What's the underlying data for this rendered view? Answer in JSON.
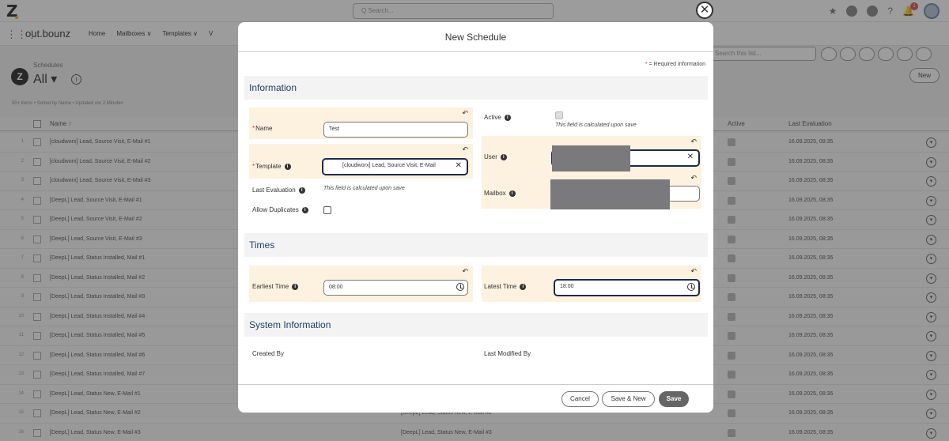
{
  "topbar": {
    "search_placeholder": "Q  Search...",
    "notification_count": "1"
  },
  "nav": {
    "app_name": "out.bounz",
    "items": [
      "Home",
      "Mailboxes ∨",
      "Templates ∨",
      "V"
    ]
  },
  "list": {
    "breadcrumb": "Schedules",
    "view": "All ▾",
    "meta": "50+ items • Sorted by Name • Updated vor 2 Minuten",
    "new_label": "New",
    "search_placeholder": "Search this list...",
    "col_name": "Name ↑",
    "col_active": "Active",
    "col_last": "Last Evaluation",
    "rows": [
      {
        "n": "1",
        "name": "[cloudworx] Lead, Source Visit, E-Mail #1",
        "tpl": "",
        "date": "16.09.2025, 08:35"
      },
      {
        "n": "2",
        "name": "[cloudworx] Lead, Source Visit, E-Mail #2",
        "tpl": "",
        "date": "16.09.2025, 08:35"
      },
      {
        "n": "3",
        "name": "[cloudworx] Lead, Source Visit, E-Mail #3",
        "tpl": "",
        "date": "16.09.2025, 08:35"
      },
      {
        "n": "4",
        "name": "[DeepL] Lead, Source Visit, E-Mail #1",
        "tpl": "",
        "date": "16.09.2025, 08:35"
      },
      {
        "n": "5",
        "name": "[DeepL] Lead, Source Visit, E-Mail #2",
        "tpl": "",
        "date": "16.09.2025, 08:35"
      },
      {
        "n": "6",
        "name": "[DeepL] Lead, Source Visit, E-Mail #3",
        "tpl": "",
        "date": "16.09.2025, 08:35"
      },
      {
        "n": "7",
        "name": "[DeepL] Lead, Status Installed, Mail #1",
        "tpl": "",
        "date": "16.09.2025, 08:35"
      },
      {
        "n": "8",
        "name": "[DeepL] Lead, Status Installed, Mail #2",
        "tpl": "",
        "date": "16.09.2025, 08:35"
      },
      {
        "n": "9",
        "name": "[DeepL] Lead, Status Installed, Mail #3",
        "tpl": "",
        "date": "16.09.2025, 08:35"
      },
      {
        "n": "10",
        "name": "[DeepL] Lead, Status Installed, Mail #4",
        "tpl": "",
        "date": "16.09.2025, 08:35"
      },
      {
        "n": "11",
        "name": "[DeepL] Lead, Status Installed, Mail #5",
        "tpl": "",
        "date": "16.09.2025, 08:35"
      },
      {
        "n": "12",
        "name": "[DeepL] Lead, Status Installed, Mail #6",
        "tpl": "",
        "date": "16.09.2025, 08:35"
      },
      {
        "n": "13",
        "name": "[DeepL] Lead, Status Installed, Mail #7",
        "tpl": "",
        "date": "16.09.2025, 08:35"
      },
      {
        "n": "14",
        "name": "[DeepL] Lead, Status New, E-Mail #1",
        "tpl": "",
        "date": "16.09.2025, 08:35"
      },
      {
        "n": "15",
        "name": "[DeepL] Lead, Status New, E-Mail #2",
        "tpl": "[DeepL] Lead, Status New, E-Mail #2",
        "date": "16.09.2025, 08:35"
      },
      {
        "n": "16",
        "name": "[DeepL] Lead, Status New, E-Mail #3",
        "tpl": "[DeepL] Lead, Status New, E-Mail #3",
        "date": "16.09.2025, 08:35"
      }
    ]
  },
  "modal": {
    "title": "New Schedule",
    "required_star": "*",
    "required_text": " = Required Information",
    "sections": {
      "information": "Information",
      "times": "Times",
      "system": "System Information"
    },
    "fields": {
      "name_label": "Name",
      "name_value": "Test",
      "template_label": "Template",
      "template_value": "[cloudworx] Lead, Source Visit, E-Mail",
      "last_eval_label": "Last Evaluation",
      "calc_note": "This field is calculated upon save",
      "allow_dup_label": "Allow Duplicates",
      "active_label": "Active",
      "user_label": "User",
      "mailbox_label": "Mailbox",
      "earliest_label": "Earliest Time",
      "earliest_value": "08:00",
      "latest_label": "Latest Time",
      "latest_value": "18:00",
      "created_by_label": "Created By",
      "modified_by_label": "Last Modified By"
    },
    "buttons": {
      "cancel": "Cancel",
      "save_new": "Save & New",
      "save": "Save"
    }
  }
}
